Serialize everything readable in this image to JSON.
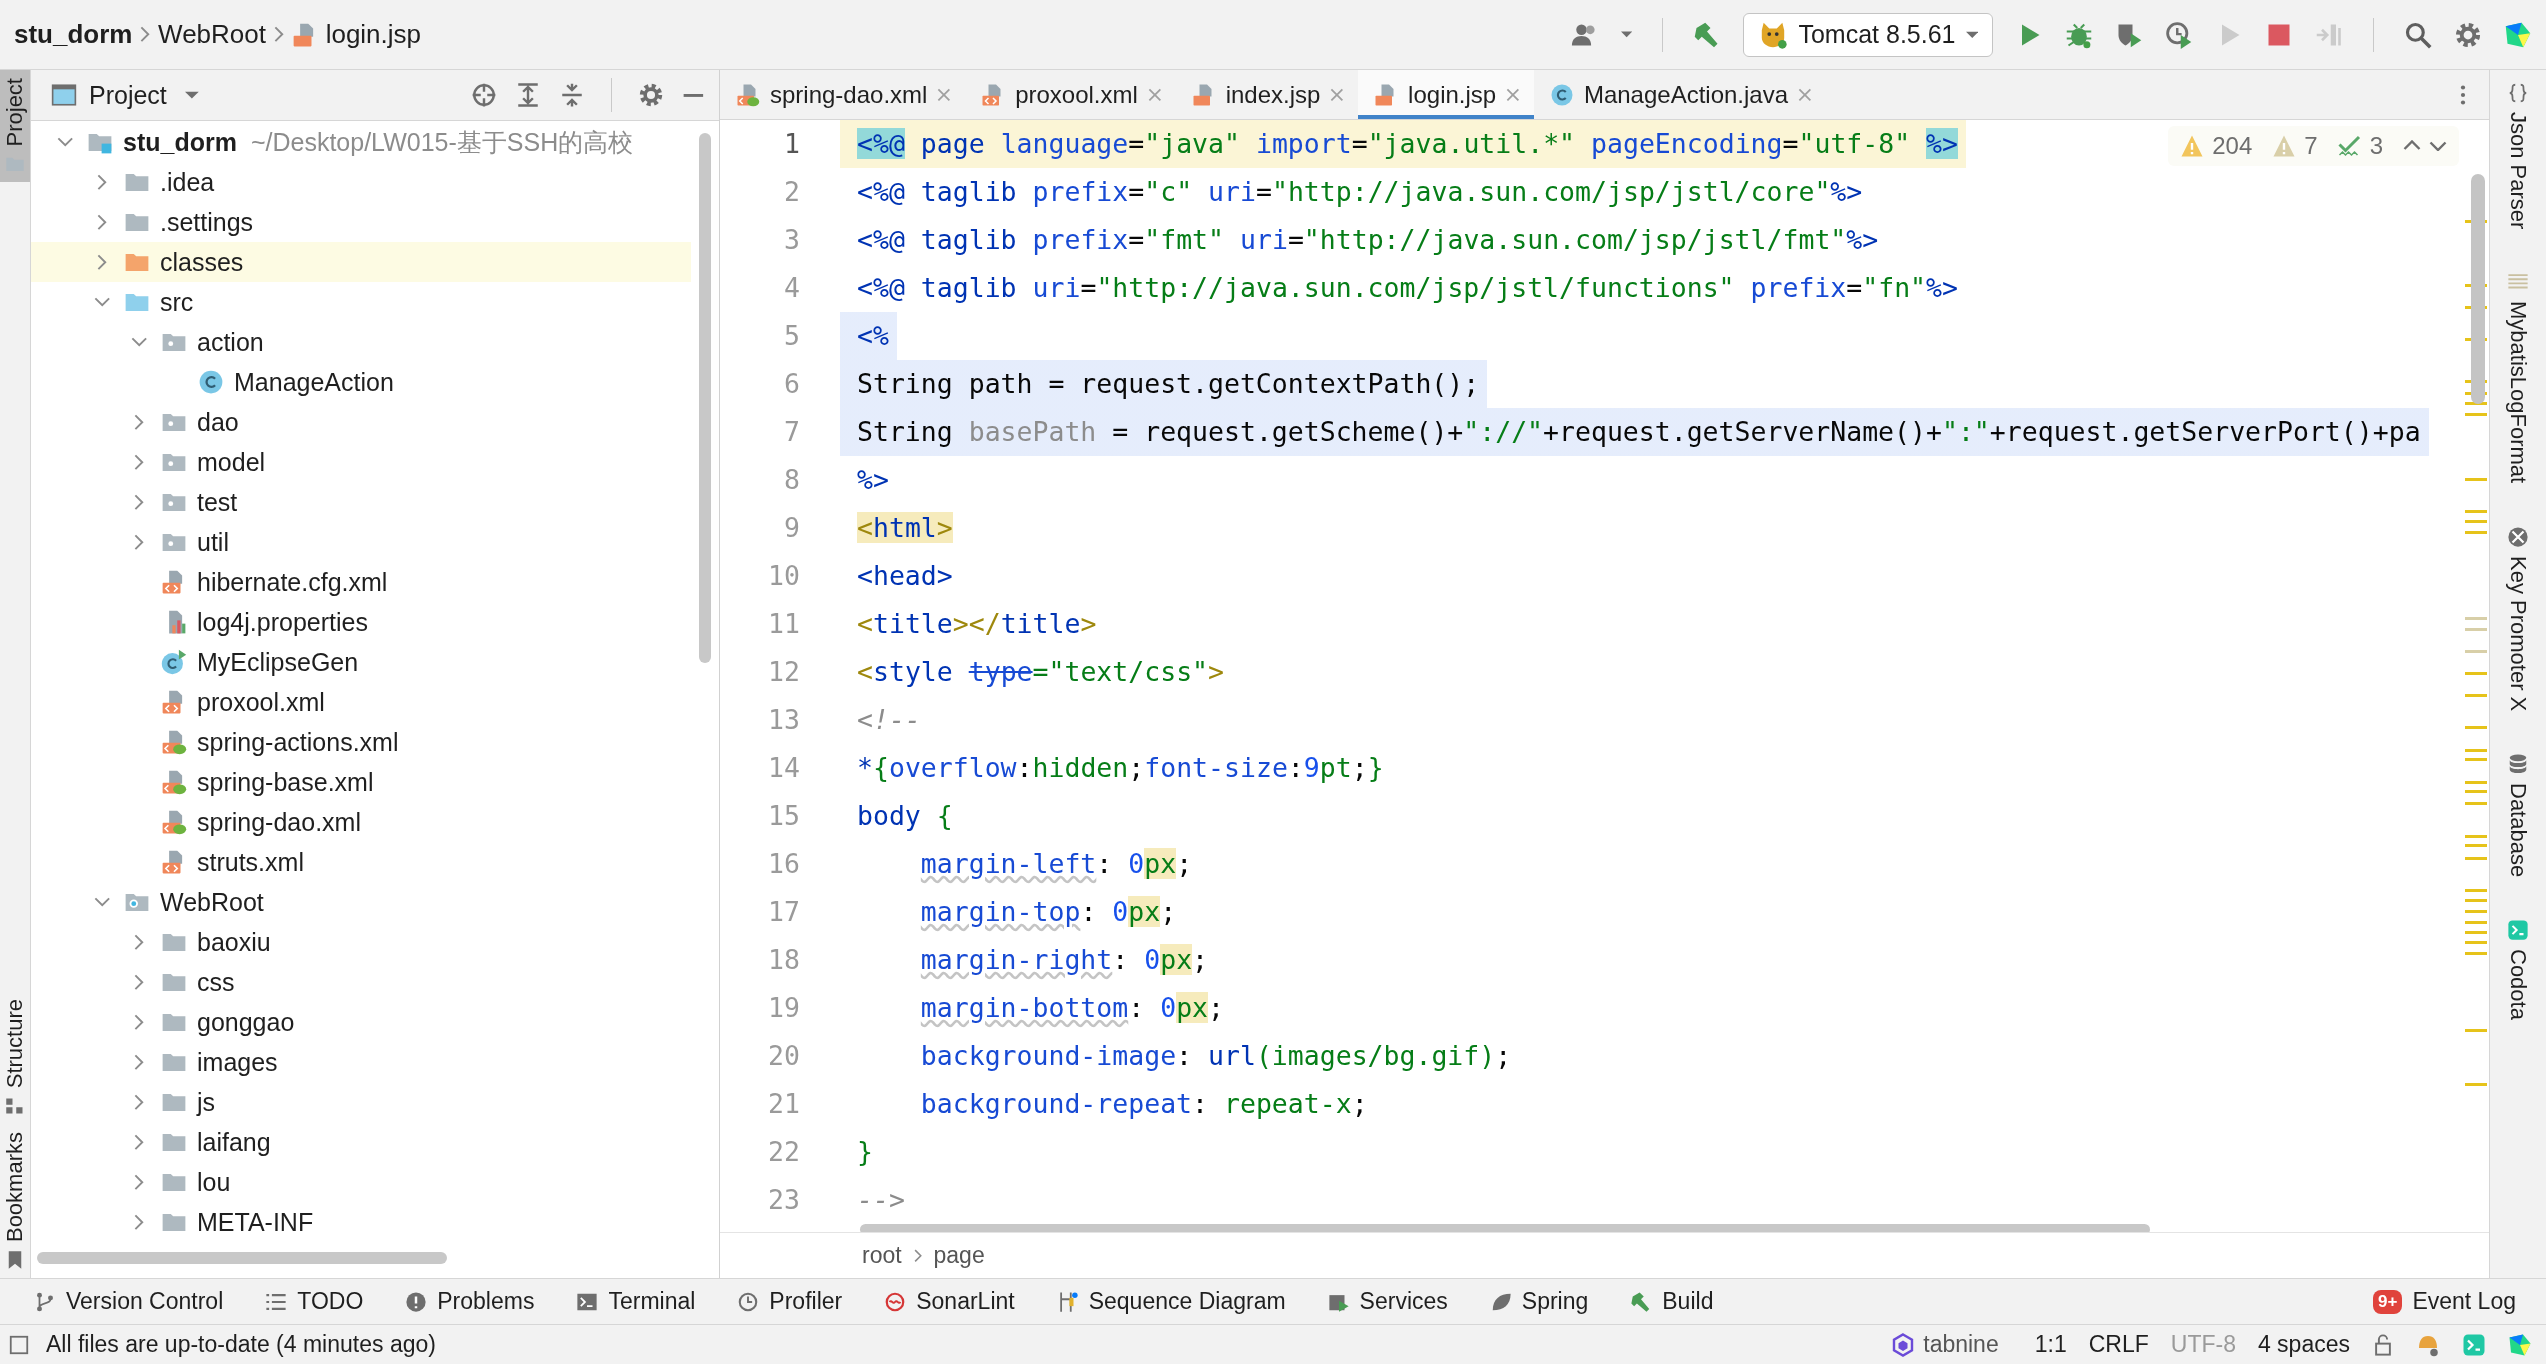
{
  "navbar": {
    "crumbs": [
      {
        "label": "stu_dorm",
        "kind": "project"
      },
      {
        "label": "WebRoot",
        "kind": "folder"
      },
      {
        "label": "login.jsp",
        "kind": "jsp"
      }
    ],
    "run_config": "Tomcat 8.5.61",
    "actions": [
      {
        "kind": "run",
        "disabled": false
      },
      {
        "kind": "debug",
        "disabled": false
      },
      {
        "kind": "coverage",
        "disabled": false
      },
      {
        "kind": "profile",
        "disabled": false
      },
      {
        "kind": "rerun",
        "disabled": true
      },
      {
        "kind": "stop",
        "disabled": false
      },
      {
        "kind": "attach",
        "disabled": true
      }
    ]
  },
  "left_strip": [
    {
      "label": "Project",
      "selected": true,
      "kind": "project"
    },
    {
      "label": "Structure",
      "selected": false,
      "kind": "structure"
    },
    {
      "label": "Bookmarks",
      "selected": false,
      "kind": "bookmarks"
    }
  ],
  "project": {
    "title": "Project",
    "tree": [
      {
        "label": "stu_dorm",
        "path": "~/Desktop/LW015-基于SSH的高校",
        "kind": "module",
        "expanded": true,
        "children": [
          {
            "label": ".idea",
            "kind": "folder",
            "expanded": false
          },
          {
            "label": ".settings",
            "kind": "folder",
            "expanded": false
          },
          {
            "label": "classes",
            "kind": "excluded",
            "expanded": false
          },
          {
            "label": "src",
            "kind": "source",
            "expanded": true,
            "children": [
              {
                "label": "action",
                "kind": "package",
                "expanded": true,
                "children": [
                  {
                    "label": "ManageAction",
                    "kind": "class"
                  }
                ]
              },
              {
                "label": "dao",
                "kind": "package",
                "expanded": false
              },
              {
                "label": "model",
                "kind": "package",
                "expanded": false
              },
              {
                "label": "test",
                "kind": "package",
                "expanded": false
              },
              {
                "label": "util",
                "kind": "package",
                "expanded": false
              },
              {
                "label": "hibernate.cfg.xml",
                "kind": "xml"
              },
              {
                "label": "log4j.properties",
                "kind": "properties"
              },
              {
                "label": "MyEclipseGen",
                "kind": "runclass"
              },
              {
                "label": "proxool.xml",
                "kind": "xml"
              },
              {
                "label": "spring-actions.xml",
                "kind": "spring"
              },
              {
                "label": "spring-base.xml",
                "kind": "spring"
              },
              {
                "label": "spring-dao.xml",
                "kind": "spring"
              },
              {
                "label": "struts.xml",
                "kind": "xml"
              }
            ]
          },
          {
            "label": "WebRoot",
            "kind": "web",
            "expanded": true,
            "children": [
              {
                "label": "baoxiu",
                "kind": "folder",
                "expanded": false
              },
              {
                "label": "css",
                "kind": "folder",
                "expanded": false
              },
              {
                "label": "gonggao",
                "kind": "folder",
                "expanded": false
              },
              {
                "label": "images",
                "kind": "folder",
                "expanded": false
              },
              {
                "label": "js",
                "kind": "folder",
                "expanded": false
              },
              {
                "label": "laifang",
                "kind": "folder",
                "expanded": false
              },
              {
                "label": "lou",
                "kind": "folder",
                "expanded": false
              },
              {
                "label": "META-INF",
                "kind": "folder",
                "expanded": false
              }
            ]
          }
        ]
      }
    ]
  },
  "tabs": [
    {
      "label": "spring-dao.xml",
      "kind": "spring",
      "selected": false
    },
    {
      "label": "proxool.xml",
      "kind": "xml",
      "selected": false
    },
    {
      "label": "index.jsp",
      "kind": "jsp",
      "selected": false
    },
    {
      "label": "login.jsp",
      "kind": "jsp",
      "selected": true
    },
    {
      "label": "ManageAction.java",
      "kind": "class",
      "selected": false
    }
  ],
  "inspections": [
    {
      "kind": "warning",
      "count": "204"
    },
    {
      "kind": "weak",
      "count": "7"
    },
    {
      "kind": "typo",
      "count": "3"
    }
  ],
  "editor": {
    "lines": [
      {
        "number": "1",
        "current": true,
        "injected": false,
        "tokens": [
          {
            "kind": "dir-m",
            "text": "<%@"
          },
          {
            "kind": "tag",
            "text": " page"
          },
          {
            "kind": "attr",
            "text": " language"
          },
          {
            "kind": "txt",
            "text": "="
          },
          {
            "kind": "str",
            "text": "\"java\""
          },
          {
            "kind": "attr",
            "text": " import"
          },
          {
            "kind": "txt",
            "text": "="
          },
          {
            "kind": "str",
            "text": "\"java.util.*\""
          },
          {
            "kind": "attr",
            "text": " pageEncoding"
          },
          {
            "kind": "txt",
            "text": "="
          },
          {
            "kind": "str",
            "text": "\"utf-8\" "
          },
          {
            "kind": "dir-m",
            "text": "%>"
          }
        ]
      },
      {
        "number": "2",
        "current": false,
        "injected": false,
        "tokens": [
          {
            "kind": "dir",
            "text": "<%@"
          },
          {
            "kind": "tag",
            "text": " taglib"
          },
          {
            "kind": "attr",
            "text": " prefix"
          },
          {
            "kind": "txt",
            "text": "="
          },
          {
            "kind": "str",
            "text": "\"c\""
          },
          {
            "kind": "attr",
            "text": " uri"
          },
          {
            "kind": "txt",
            "text": "="
          },
          {
            "kind": "str",
            "text": "\"http://java.sun.com/jsp/jstl/core\""
          },
          {
            "kind": "dir",
            "text": "%>"
          }
        ]
      },
      {
        "number": "3",
        "current": false,
        "injected": false,
        "tokens": [
          {
            "kind": "dir",
            "text": "<%@"
          },
          {
            "kind": "tag",
            "text": " taglib"
          },
          {
            "kind": "attr",
            "text": " prefix"
          },
          {
            "kind": "txt",
            "text": "="
          },
          {
            "kind": "str",
            "text": "\"fmt\""
          },
          {
            "kind": "attr",
            "text": " uri"
          },
          {
            "kind": "txt",
            "text": "="
          },
          {
            "kind": "str",
            "text": "\"http://java.sun.com/jsp/jstl/fmt\""
          },
          {
            "kind": "dir",
            "text": "%>"
          }
        ]
      },
      {
        "number": "4",
        "current": false,
        "injected": false,
        "tokens": [
          {
            "kind": "dir",
            "text": "<%@"
          },
          {
            "kind": "tag",
            "text": " taglib"
          },
          {
            "kind": "attr",
            "text": " uri"
          },
          {
            "kind": "txt",
            "text": "="
          },
          {
            "kind": "str",
            "text": "\"http://java.sun.com/jsp/jstl/functions\""
          },
          {
            "kind": "attr",
            "text": " prefix"
          },
          {
            "kind": "txt",
            "text": "="
          },
          {
            "kind": "str",
            "text": "\"fn\""
          },
          {
            "kind": "dir",
            "text": "%>"
          }
        ]
      },
      {
        "number": "5",
        "current": false,
        "injected": true,
        "tokens": [
          {
            "kind": "dir",
            "text": "<%"
          }
        ]
      },
      {
        "number": "6",
        "current": false,
        "injected": true,
        "tokens": [
          {
            "kind": "txt",
            "text": "String path = request.getContextPath();"
          }
        ]
      },
      {
        "number": "7",
        "current": false,
        "injected": true,
        "tokens": [
          {
            "kind": "txt",
            "text": "String "
          },
          {
            "kind": "unused",
            "text": "basePath"
          },
          {
            "kind": "txt",
            "text": " = request.getScheme()+"
          },
          {
            "kind": "str",
            "text": "\"://\""
          },
          {
            "kind": "txt",
            "text": "+request.getServerName()+"
          },
          {
            "kind": "str",
            "text": "\":\""
          },
          {
            "kind": "txt",
            "text": "+request.getServerPort()+pa"
          }
        ]
      },
      {
        "number": "8",
        "current": false,
        "injected": false,
        "tokens": [
          {
            "kind": "dir",
            "text": "%>"
          }
        ]
      },
      {
        "number": "9",
        "current": false,
        "injected": false,
        "tokens": [
          {
            "kind": "br-m",
            "text": "<"
          },
          {
            "kind": "tag-m",
            "text": "html"
          },
          {
            "kind": "br-m",
            "text": ">"
          }
        ]
      },
      {
        "number": "10",
        "current": false,
        "injected": false,
        "tokens": [
          {
            "kind": "tag",
            "text": "<head>"
          }
        ]
      },
      {
        "number": "11",
        "current": false,
        "injected": false,
        "tokens": [
          {
            "kind": "br",
            "text": "<"
          },
          {
            "kind": "tag",
            "text": "title"
          },
          {
            "kind": "br",
            "text": "></"
          },
          {
            "kind": "tag",
            "text": "title"
          },
          {
            "kind": "br",
            "text": ">"
          }
        ]
      },
      {
        "number": "12",
        "current": false,
        "injected": false,
        "tokens": [
          {
            "kind": "br",
            "text": "<"
          },
          {
            "kind": "tag",
            "text": "style"
          },
          {
            "kind": "dep",
            "text": " type"
          },
          {
            "kind": "str",
            "text": "=\"text/css\""
          },
          {
            "kind": "br",
            "text": ">"
          }
        ]
      },
      {
        "number": "13",
        "current": false,
        "injected": false,
        "tokens": [
          {
            "kind": "cm",
            "text": "<!--"
          }
        ]
      },
      {
        "number": "14",
        "current": false,
        "injected": false,
        "tokens": [
          {
            "kind": "sel",
            "text": "*"
          },
          {
            "kind": "val",
            "text": "{"
          },
          {
            "kind": "prop",
            "text": "overflow"
          },
          {
            "kind": "txt",
            "text": ":"
          },
          {
            "kind": "val",
            "text": "hidden"
          },
          {
            "kind": "txt",
            "text": ";"
          },
          {
            "kind": "prop",
            "text": "font-size"
          },
          {
            "kind": "txt",
            "text": ":"
          },
          {
            "kind": "num",
            "text": "9"
          },
          {
            "kind": "val",
            "text": "pt"
          },
          {
            "kind": "txt",
            "text": ";"
          },
          {
            "kind": "val",
            "text": "}"
          }
        ]
      },
      {
        "number": "15",
        "current": false,
        "injected": false,
        "tokens": [
          {
            "kind": "sel",
            "text": "body"
          },
          {
            "kind": "val",
            "text": " {"
          }
        ]
      },
      {
        "number": "16",
        "current": false,
        "injected": false,
        "tokens": [
          {
            "kind": "propw",
            "text": "    margin-left"
          },
          {
            "kind": "txt",
            "text": ": "
          },
          {
            "kind": "num",
            "text": "0"
          },
          {
            "kind": "unit",
            "text": "px"
          },
          {
            "kind": "txt",
            "text": ";"
          }
        ]
      },
      {
        "number": "17",
        "current": false,
        "injected": false,
        "tokens": [
          {
            "kind": "propw",
            "text": "    margin-top"
          },
          {
            "kind": "txt",
            "text": ": "
          },
          {
            "kind": "num",
            "text": "0"
          },
          {
            "kind": "unit",
            "text": "px"
          },
          {
            "kind": "txt",
            "text": ";"
          }
        ]
      },
      {
        "number": "18",
        "current": false,
        "injected": false,
        "tokens": [
          {
            "kind": "propw",
            "text": "    margin-right"
          },
          {
            "kind": "txt",
            "text": ": "
          },
          {
            "kind": "num",
            "text": "0"
          },
          {
            "kind": "unit",
            "text": "px"
          },
          {
            "kind": "txt",
            "text": ";"
          }
        ]
      },
      {
        "number": "19",
        "current": false,
        "injected": false,
        "tokens": [
          {
            "kind": "propw",
            "text": "    margin-bottom"
          },
          {
            "kind": "txt",
            "text": ": "
          },
          {
            "kind": "num",
            "text": "0"
          },
          {
            "kind": "unit",
            "text": "px"
          },
          {
            "kind": "txt",
            "text": ";"
          }
        ]
      },
      {
        "number": "20",
        "current": false,
        "injected": false,
        "tokens": [
          {
            "kind": "prop",
            "text": "    background-image"
          },
          {
            "kind": "txt",
            "text": ": "
          },
          {
            "kind": "sel",
            "text": "url"
          },
          {
            "kind": "val",
            "text": "(images/bg.gif)"
          },
          {
            "kind": "txt",
            "text": ";"
          }
        ]
      },
      {
        "number": "21",
        "current": false,
        "injected": false,
        "tokens": [
          {
            "kind": "prop",
            "text": "    background-repeat"
          },
          {
            "kind": "txt",
            "text": ": "
          },
          {
            "kind": "val",
            "text": "repeat-x"
          },
          {
            "kind": "txt",
            "text": ";"
          }
        ]
      },
      {
        "number": "22",
        "current": false,
        "injected": false,
        "tokens": [
          {
            "kind": "val",
            "text": "}"
          }
        ]
      },
      {
        "number": "23",
        "current": false,
        "injected": false,
        "tokens": [
          {
            "kind": "cm",
            "text": "-->"
          }
        ]
      }
    ],
    "breadcrumbs": [
      "root",
      "page"
    ]
  },
  "right_strip": [
    {
      "label": "Json Parser",
      "kind": "braces"
    },
    {
      "label": "MybatisLogFormat",
      "kind": "lines"
    },
    {
      "label": "Key Promoter X",
      "kind": "keypromoter"
    },
    {
      "label": "Database",
      "kind": "database"
    },
    {
      "label": "Codota",
      "kind": "codota"
    }
  ],
  "tool_windows": [
    {
      "label": "Version Control",
      "kind": "vcs"
    },
    {
      "label": "TODO",
      "kind": "todo"
    },
    {
      "label": "Problems",
      "kind": "problems"
    },
    {
      "label": "Terminal",
      "kind": "terminal"
    },
    {
      "label": "Profiler",
      "kind": "profiler"
    },
    {
      "label": "SonarLint",
      "kind": "sonar"
    },
    {
      "label": "Sequence Diagram",
      "kind": "sequence"
    },
    {
      "label": "Services",
      "kind": "services"
    },
    {
      "label": "Spring",
      "kind": "spring-leaf"
    },
    {
      "label": "Build",
      "kind": "hammer"
    }
  ],
  "event_log": {
    "label": "Event Log",
    "badge": "9+"
  },
  "status_bar": {
    "message": "All files are up-to-date (4 minutes ago)",
    "plugin": "tabnine",
    "items": [
      {
        "text": "1:1",
        "dimmed": false
      },
      {
        "text": "CRLF",
        "dimmed": false
      },
      {
        "text": "UTF-8",
        "dimmed": true
      },
      {
        "text": "4 spaces",
        "dimmed": false
      }
    ]
  }
}
